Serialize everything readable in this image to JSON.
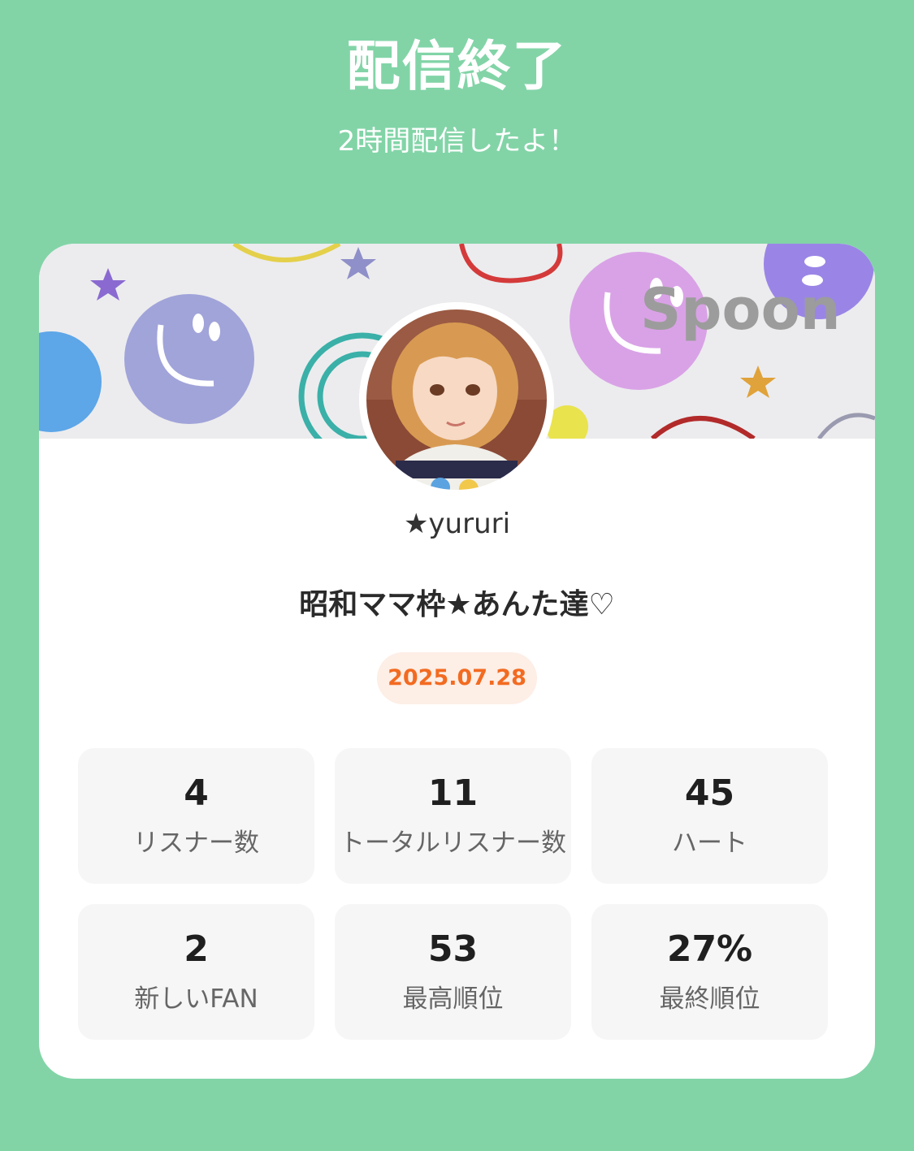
{
  "header": {
    "title": "配信終了",
    "subtitle": "2時間配信したよ！"
  },
  "card": {
    "banner": {
      "watermark": "Spoon"
    },
    "avatar": {
      "label": "user-avatar"
    },
    "username": "★yururi",
    "live_title": "昭和ママ枠★あんた達♡",
    "date": "2025.07.28",
    "stats": [
      {
        "value": "4",
        "label": "リスナー数"
      },
      {
        "value": "11",
        "label": "トータルリスナー数"
      },
      {
        "value": "45",
        "label": "ハート"
      },
      {
        "value": "2",
        "label": "新しいFAN"
      },
      {
        "value": "53",
        "label": "最高順位"
      },
      {
        "value": "27%",
        "label": "最終順位"
      }
    ]
  },
  "colors": {
    "background": "#82d4a7",
    "card": "#ffffff",
    "accent": "#f26b21",
    "badge_bg": "#fdeee6",
    "stat_bg": "#f6f6f6"
  }
}
